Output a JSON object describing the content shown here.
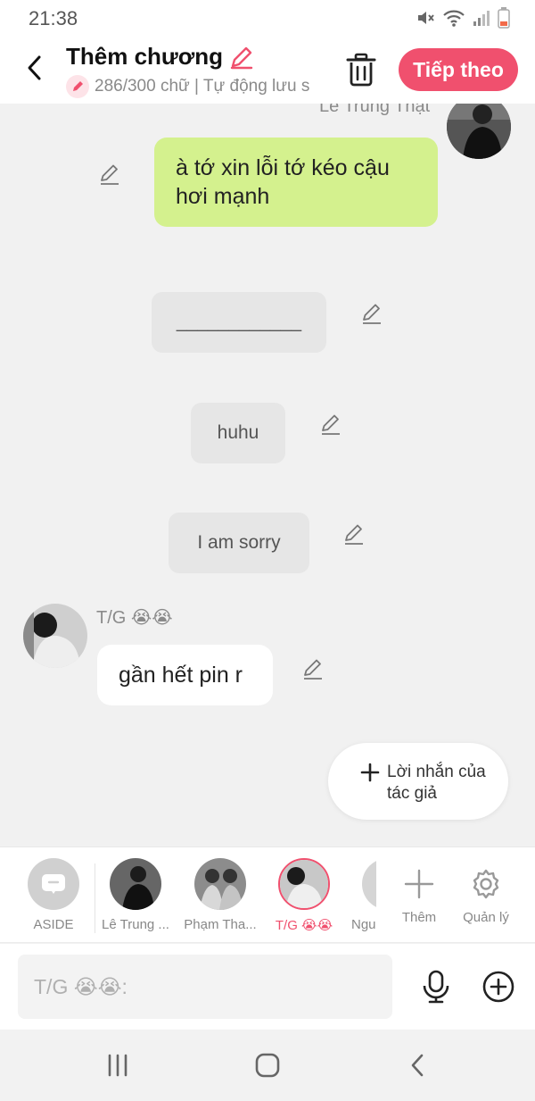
{
  "status_bar": {
    "time": "21:38",
    "icons": [
      "mute-icon",
      "wifi-icon",
      "signal-icon",
      "battery-icon"
    ]
  },
  "header": {
    "title": "Thêm chương",
    "subtitle": "286/300 chữ | Tự động lưu s",
    "next_label": "Tiếp theo",
    "accent_color": "#f0506e"
  },
  "chat": {
    "top_sender": "Lê Trung Thật",
    "messages": [
      {
        "text": "à tớ xin lỗi tớ kéo cậu hơi mạnh",
        "style": "green",
        "color": "#d4f18e"
      },
      {
        "text": "____________",
        "style": "aside"
      },
      {
        "text": "huhu",
        "style": "aside"
      },
      {
        "text": "I am sorry",
        "style": "aside"
      },
      {
        "sender": "T/G 😭😭",
        "text": "gần hết pin r",
        "style": "white"
      }
    ],
    "author_message_label": "Lời nhắn của tác giả"
  },
  "characters": [
    {
      "label": "ASIDE"
    },
    {
      "label": "Lê Trung ..."
    },
    {
      "label": "Phạm Tha..."
    },
    {
      "label": "T/G 😭😭",
      "selected": true
    },
    {
      "label": "Ngu"
    },
    {
      "label": "Thêm"
    },
    {
      "label": "Quản lý"
    }
  ],
  "input": {
    "placeholder": "T/G 😭😭:"
  },
  "nav_bar": {
    "icons": [
      "recents-icon",
      "home-icon",
      "back-icon"
    ]
  }
}
